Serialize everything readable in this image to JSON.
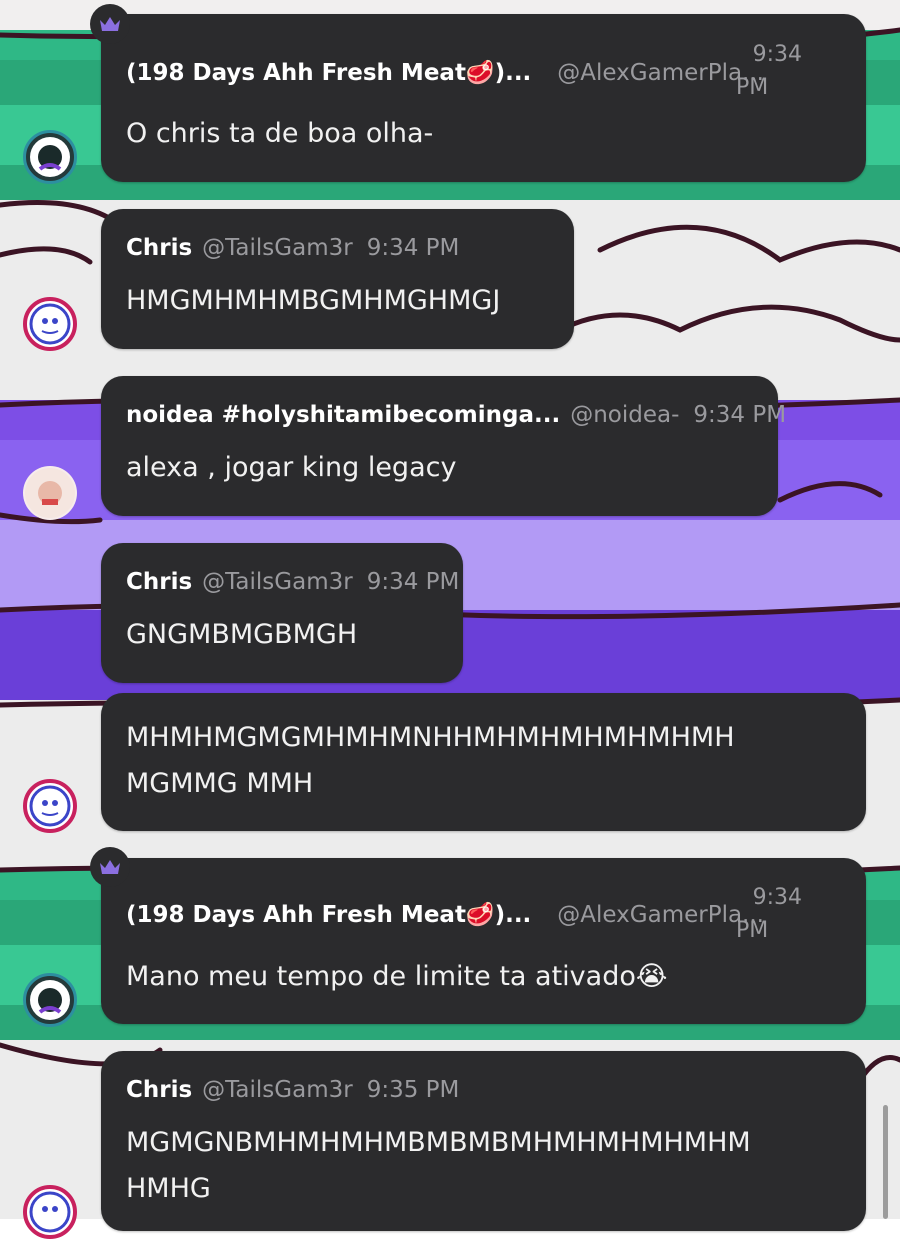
{
  "messages": [
    {
      "name": "(198 Days Ahh Fresh Meat🥩)...",
      "handle": "@AlexGamerPla...",
      "time_line1": "9:34",
      "time_line2": "PM",
      "text": "O chris ta de boa olha-"
    },
    {
      "name": "Chris",
      "handle": "@TailsGam3r",
      "time": "9:34 PM",
      "text": "HMGMHMHMBGMHMGHMGJ"
    },
    {
      "name": "noidea #holyshitamibecominga...",
      "handle": "@noidea-",
      "time": "9:34 PM",
      "text": "alexa , jogar king legacy"
    },
    {
      "name": "Chris",
      "handle": "@TailsGam3r",
      "time": "9:34 PM",
      "text": "GNGMBMGBMGH"
    },
    {
      "text_line1": "MHMHMGMGMHMHMNHHMHMHMHMHMHMH",
      "text_line2": "MGMMG MMH"
    },
    {
      "name": "(198 Days Ahh Fresh Meat🥩)...",
      "handle": "@AlexGamerPla...",
      "time_line1": "9:34",
      "time_line2": "PM",
      "text": "Mano meu tempo de limite ta ativado😭"
    },
    {
      "name": "Chris",
      "handle": "@TailsGam3r",
      "time": "9:35 PM",
      "text_line1": "MGMGNBMHMHMHMBMBMBMHMHMHMHMHM",
      "text_line2": "HMHG"
    }
  ],
  "colors": {
    "bubble": "#2b2b2d",
    "crown": "#8b6fe0",
    "green": "#2fb886",
    "purple": "#7d4ee6"
  },
  "icons": [
    "crown-icon",
    "avatar-alex",
    "avatar-chris",
    "avatar-noidea"
  ]
}
